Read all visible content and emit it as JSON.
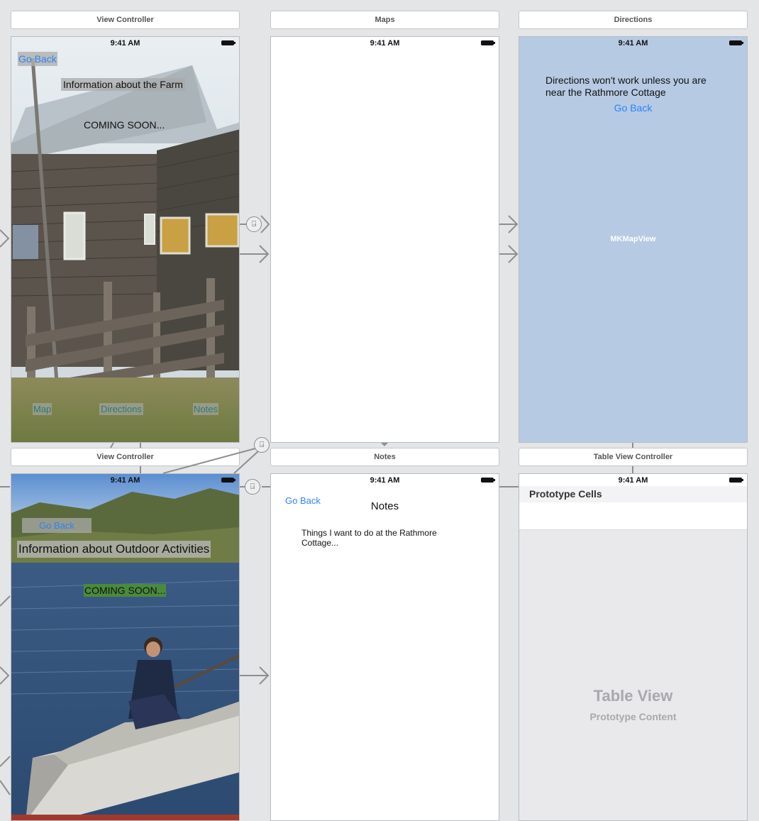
{
  "status_time": "9:41 AM",
  "scenes": {
    "farm": {
      "title": "View Controller",
      "go_back": "Go Back",
      "heading": "Information about the Farm",
      "coming_soon": "COMING SOON...",
      "buttons": [
        "Map",
        "Directions",
        "Notes"
      ]
    },
    "maps": {
      "title": "Maps"
    },
    "directions": {
      "title": "Directions",
      "message": "Directions won't work unless you are near the Rathmore Cottage",
      "go_back": "Go Back",
      "map_label": "MKMapView"
    },
    "outdoor": {
      "title": "View Controller",
      "go_back": "Go Back",
      "heading": "Information about Outdoor Activities",
      "coming_soon": "COMING SOON..."
    },
    "notes": {
      "title": "Notes",
      "go_back": "Go Back",
      "nav_title": "Notes",
      "body": "Things I want to do at the Rathmore Cottage..."
    },
    "table": {
      "title": "Table View Controller",
      "prototype_cells": "Prototype Cells",
      "table_view": "Table View",
      "prototype_content": "Prototype Content"
    }
  },
  "colors": {
    "canvas": "#e4e5e7",
    "link": "#2c84f5",
    "map_blue": "#b6cae3",
    "coming_soon_green": "#4a8a3c"
  },
  "icons": [
    "segue-icon",
    "arrow-icon",
    "battery-icon"
  ]
}
